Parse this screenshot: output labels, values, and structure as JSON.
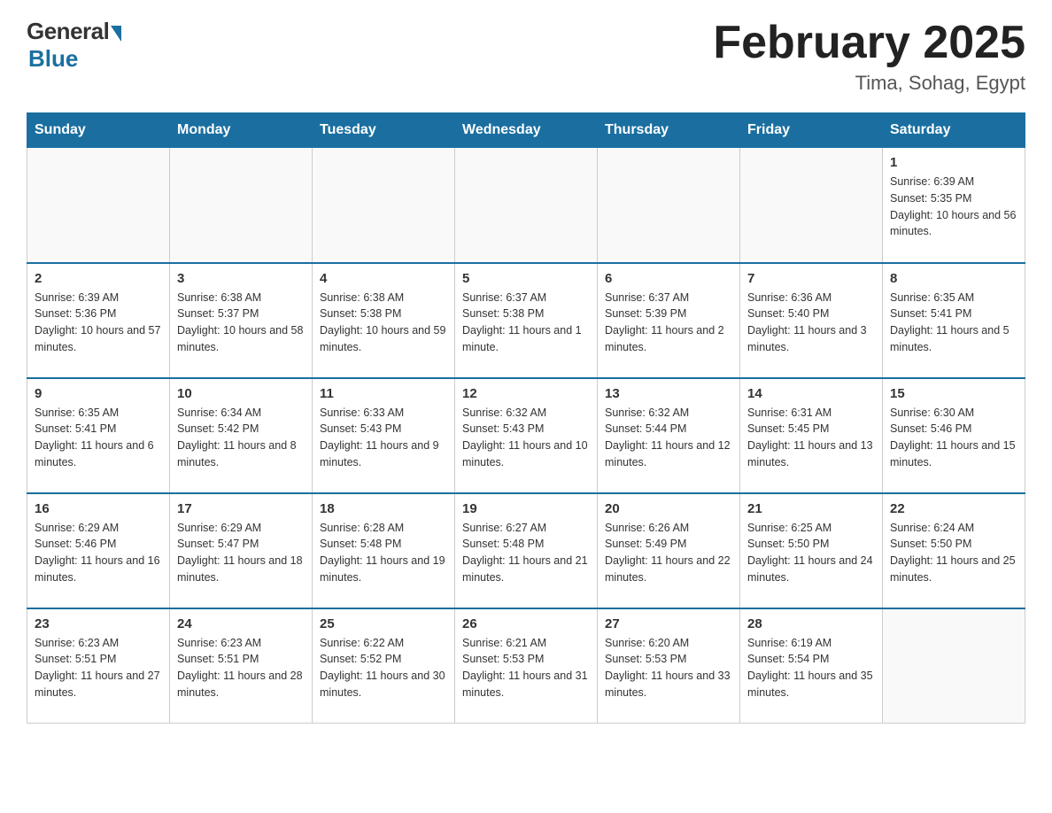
{
  "header": {
    "logo": {
      "general": "General",
      "blue": "Blue"
    },
    "title": "February 2025",
    "location": "Tima, Sohag, Egypt"
  },
  "days_of_week": [
    "Sunday",
    "Monday",
    "Tuesday",
    "Wednesday",
    "Thursday",
    "Friday",
    "Saturday"
  ],
  "weeks": [
    [
      {
        "day": "",
        "info": ""
      },
      {
        "day": "",
        "info": ""
      },
      {
        "day": "",
        "info": ""
      },
      {
        "day": "",
        "info": ""
      },
      {
        "day": "",
        "info": ""
      },
      {
        "day": "",
        "info": ""
      },
      {
        "day": "1",
        "info": "Sunrise: 6:39 AM\nSunset: 5:35 PM\nDaylight: 10 hours and 56 minutes."
      }
    ],
    [
      {
        "day": "2",
        "info": "Sunrise: 6:39 AM\nSunset: 5:36 PM\nDaylight: 10 hours and 57 minutes."
      },
      {
        "day": "3",
        "info": "Sunrise: 6:38 AM\nSunset: 5:37 PM\nDaylight: 10 hours and 58 minutes."
      },
      {
        "day": "4",
        "info": "Sunrise: 6:38 AM\nSunset: 5:38 PM\nDaylight: 10 hours and 59 minutes."
      },
      {
        "day": "5",
        "info": "Sunrise: 6:37 AM\nSunset: 5:38 PM\nDaylight: 11 hours and 1 minute."
      },
      {
        "day": "6",
        "info": "Sunrise: 6:37 AM\nSunset: 5:39 PM\nDaylight: 11 hours and 2 minutes."
      },
      {
        "day": "7",
        "info": "Sunrise: 6:36 AM\nSunset: 5:40 PM\nDaylight: 11 hours and 3 minutes."
      },
      {
        "day": "8",
        "info": "Sunrise: 6:35 AM\nSunset: 5:41 PM\nDaylight: 11 hours and 5 minutes."
      }
    ],
    [
      {
        "day": "9",
        "info": "Sunrise: 6:35 AM\nSunset: 5:41 PM\nDaylight: 11 hours and 6 minutes."
      },
      {
        "day": "10",
        "info": "Sunrise: 6:34 AM\nSunset: 5:42 PM\nDaylight: 11 hours and 8 minutes."
      },
      {
        "day": "11",
        "info": "Sunrise: 6:33 AM\nSunset: 5:43 PM\nDaylight: 11 hours and 9 minutes."
      },
      {
        "day": "12",
        "info": "Sunrise: 6:32 AM\nSunset: 5:43 PM\nDaylight: 11 hours and 10 minutes."
      },
      {
        "day": "13",
        "info": "Sunrise: 6:32 AM\nSunset: 5:44 PM\nDaylight: 11 hours and 12 minutes."
      },
      {
        "day": "14",
        "info": "Sunrise: 6:31 AM\nSunset: 5:45 PM\nDaylight: 11 hours and 13 minutes."
      },
      {
        "day": "15",
        "info": "Sunrise: 6:30 AM\nSunset: 5:46 PM\nDaylight: 11 hours and 15 minutes."
      }
    ],
    [
      {
        "day": "16",
        "info": "Sunrise: 6:29 AM\nSunset: 5:46 PM\nDaylight: 11 hours and 16 minutes."
      },
      {
        "day": "17",
        "info": "Sunrise: 6:29 AM\nSunset: 5:47 PM\nDaylight: 11 hours and 18 minutes."
      },
      {
        "day": "18",
        "info": "Sunrise: 6:28 AM\nSunset: 5:48 PM\nDaylight: 11 hours and 19 minutes."
      },
      {
        "day": "19",
        "info": "Sunrise: 6:27 AM\nSunset: 5:48 PM\nDaylight: 11 hours and 21 minutes."
      },
      {
        "day": "20",
        "info": "Sunrise: 6:26 AM\nSunset: 5:49 PM\nDaylight: 11 hours and 22 minutes."
      },
      {
        "day": "21",
        "info": "Sunrise: 6:25 AM\nSunset: 5:50 PM\nDaylight: 11 hours and 24 minutes."
      },
      {
        "day": "22",
        "info": "Sunrise: 6:24 AM\nSunset: 5:50 PM\nDaylight: 11 hours and 25 minutes."
      }
    ],
    [
      {
        "day": "23",
        "info": "Sunrise: 6:23 AM\nSunset: 5:51 PM\nDaylight: 11 hours and 27 minutes."
      },
      {
        "day": "24",
        "info": "Sunrise: 6:23 AM\nSunset: 5:51 PM\nDaylight: 11 hours and 28 minutes."
      },
      {
        "day": "25",
        "info": "Sunrise: 6:22 AM\nSunset: 5:52 PM\nDaylight: 11 hours and 30 minutes."
      },
      {
        "day": "26",
        "info": "Sunrise: 6:21 AM\nSunset: 5:53 PM\nDaylight: 11 hours and 31 minutes."
      },
      {
        "day": "27",
        "info": "Sunrise: 6:20 AM\nSunset: 5:53 PM\nDaylight: 11 hours and 33 minutes."
      },
      {
        "day": "28",
        "info": "Sunrise: 6:19 AM\nSunset: 5:54 PM\nDaylight: 11 hours and 35 minutes."
      },
      {
        "day": "",
        "info": ""
      }
    ]
  ]
}
